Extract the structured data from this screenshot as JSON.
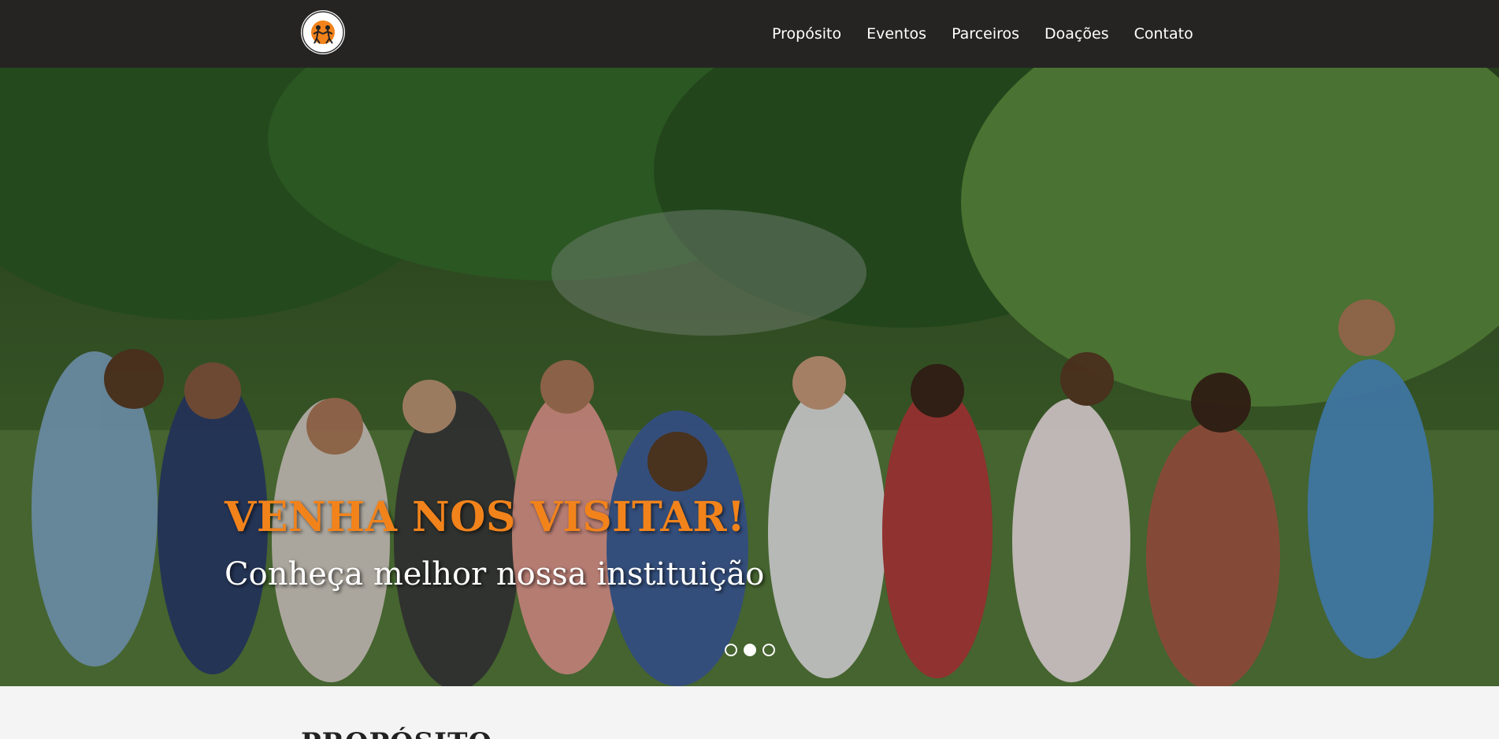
{
  "header": {
    "logo_alt": "Logo da instituição",
    "nav": [
      {
        "label": "Propósito"
      },
      {
        "label": "Eventos"
      },
      {
        "label": "Parceiros"
      },
      {
        "label": "Doações"
      },
      {
        "label": "Contato"
      }
    ]
  },
  "hero": {
    "title": "VENHA NOS VISITAR!",
    "subtitle": "Conheça melhor nossa instituição",
    "slide_count": 3,
    "active_slide": 2
  },
  "section": {
    "title": "PROPÓSITO"
  },
  "colors": {
    "nav_bg": "#252423",
    "accent": "#f2831b",
    "text_light": "#ffffff",
    "page_bg": "#f4f4f4"
  }
}
